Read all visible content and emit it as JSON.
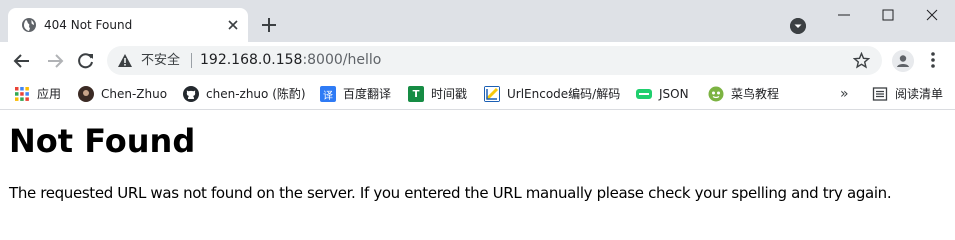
{
  "tab": {
    "title": "404 Not Found",
    "favicon": "globe-icon"
  },
  "toolbar": {
    "security_label": "不安全",
    "url_host": "192.168.0.158",
    "url_rest": ":8000/hello"
  },
  "bookmarks": [
    {
      "label": "应用",
      "icon": "apps-grid-icon"
    },
    {
      "label": "Chen-Zhuo",
      "icon": "avatar-icon"
    },
    {
      "label": "chen-zhuo (陈酌)",
      "icon": "github-icon"
    },
    {
      "label": "百度翻译",
      "icon": "translate-icon",
      "glyph": "译",
      "color": "#2f7bf5"
    },
    {
      "label": "时间戳",
      "icon": "timestamp-icon",
      "glyph": "T",
      "color": "#168c44"
    },
    {
      "label": "UrlEncode编码/解码",
      "icon": "urlencode-icon"
    },
    {
      "label": "JSON",
      "icon": "json-icon",
      "color": "#1fcf6e"
    },
    {
      "label": "菜鸟教程",
      "icon": "runoob-icon",
      "color": "#7cb342"
    }
  ],
  "reading_list": {
    "overflow": "»",
    "label": "阅读清单"
  },
  "page": {
    "heading": "Not Found",
    "message": "The requested URL was not found on the server. If you entered the URL manually please check your spelling and try again."
  }
}
